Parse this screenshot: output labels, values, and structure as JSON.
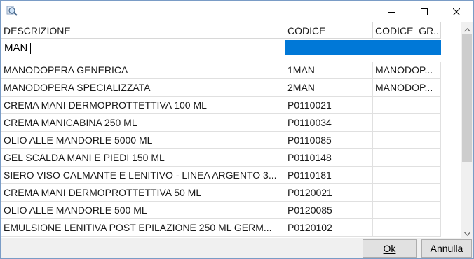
{
  "window": {
    "icon": "magnifier-icon",
    "controls": [
      "minimize-icon",
      "maximize-icon",
      "close-icon"
    ]
  },
  "grid": {
    "columns": [
      "DESCRIZIONE",
      "CODICE",
      "CODICE_GR..."
    ],
    "filter": {
      "descrizione": "MAN",
      "selection_color": "#0078d7"
    },
    "rows": [
      [
        "MANODOPERA GENERICA",
        "1MAN",
        "MANODOP..."
      ],
      [
        "MANODOPERA SPECIALIZZATA",
        "2MAN",
        "MANODOP..."
      ],
      [
        "CREMA MANI DERMOPROTTETTIVA 100 ML",
        "P0110021",
        ""
      ],
      [
        "CREMA MANICABINA 250 ML",
        "P0110034",
        ""
      ],
      [
        "OLIO ALLE MANDORLE 5000 ML",
        "P0110085",
        ""
      ],
      [
        "GEL SCALDA MANI E PIEDI 150 ML",
        "P0110148",
        ""
      ],
      [
        "SIERO VISO CALMANTE E LENITIVO - LINEA ARGENTO 3...",
        "P0110181",
        ""
      ],
      [
        "CREMA MANI DERMOPROTTETTIVA 50 ML",
        "P0120021",
        ""
      ],
      [
        "OLIO ALLE MANDORLE 500 ML",
        "P0120085",
        ""
      ],
      [
        "EMULSIONE LENITIVA POST EPILAZIONE 250 ML GERM...",
        "P0120102",
        ""
      ]
    ]
  },
  "buttons": {
    "ok": "Ok",
    "cancel": "Annulla"
  }
}
